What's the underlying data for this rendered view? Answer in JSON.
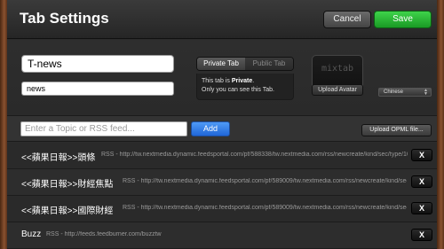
{
  "header": {
    "title": "Tab Settings",
    "cancel_label": "Cancel",
    "save_label": "Save"
  },
  "tab": {
    "name_value": "T-news",
    "slug_value": "news",
    "private_label": "Private Tab",
    "public_label": "Public Tab",
    "info_prefix": "This tab is ",
    "info_state": "Private",
    "info_suffix": ".",
    "info_line2": "Only you can see this Tab.",
    "avatar_logo": "mixtab",
    "upload_avatar_label": "Upload Avatar",
    "language_value": "Chinese"
  },
  "feed_bar": {
    "placeholder": "Enter a Topic or RSS feed...",
    "add_label": "Add",
    "upload_opml_label": "Upload OPML file..."
  },
  "feeds": [
    {
      "title": "<<蘋果日報>>頭條",
      "url": "RSS - http://tw.nextmedia.dynamic.feedsportal.com/pf/588338/tw.nextmedia.com/rss/newcreate/kind/sec/type/1077"
    },
    {
      "title": "<<蘋果日報>>財經焦點",
      "url": "RSS - http://tw.nextmedia.dynamic.feedsportal.com/pf/589009/tw.nextmedia.com/rss/newcreate/kind/sec/type/"
    },
    {
      "title": "<<蘋果日報>>國際財經",
      "url": "RSS - http://tw.nextmedia.dynamic.feedsportal.com/pf/589009/tw.nextmedia.com/rss/newcreate/kind/sec/type/"
    },
    {
      "title": "Buzz",
      "url": "RSS - http://feeds.feedburner.com/buzztw"
    }
  ],
  "remove_label": "X",
  "colors": {
    "save_green": "#1a9a25",
    "add_blue": "#2067d8",
    "panel_bg": "#2b2b2b"
  }
}
